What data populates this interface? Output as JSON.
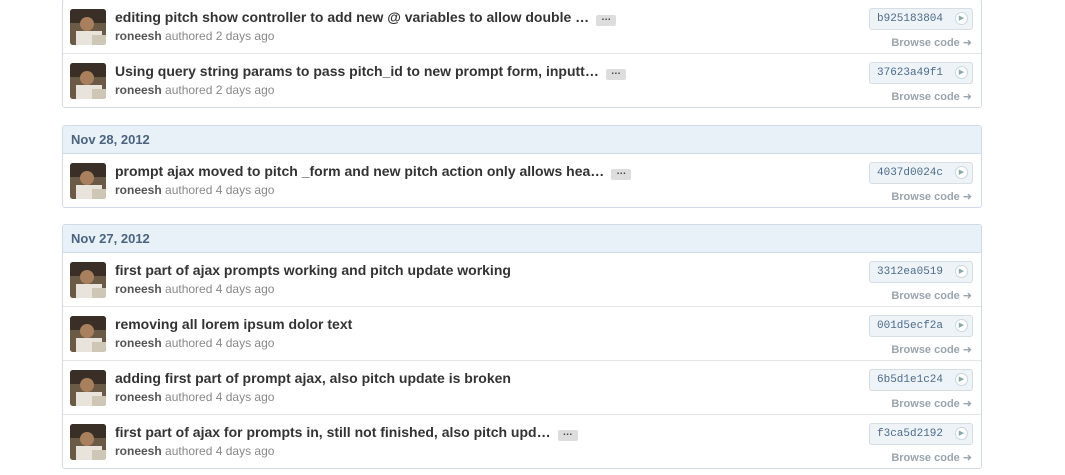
{
  "groups": [
    {
      "date": "",
      "commits": [
        {
          "message": "editing pitch show controller to add new @ variables to allow double …",
          "author": "roneesh",
          "authored": "authored 2 days ago",
          "sha": "b925183804",
          "browse": "Browse code"
        },
        {
          "message": "Using query string params to pass pitch_id to new prompt form, inputt…",
          "author": "roneesh",
          "authored": "authored 2 days ago",
          "sha": "37623a49f1",
          "browse": "Browse code"
        }
      ]
    },
    {
      "date": "Nov 28, 2012",
      "commits": [
        {
          "message": "prompt ajax moved to pitch _form and new pitch action only allows hea…",
          "author": "roneesh",
          "authored": "authored 4 days ago",
          "sha": "4037d0024c",
          "browse": "Browse code"
        }
      ]
    },
    {
      "date": "Nov 27, 2012",
      "commits": [
        {
          "message": "first part of ajax prompts working and pitch update working",
          "author": "roneesh",
          "authored": "authored 4 days ago",
          "sha": "3312ea0519",
          "browse": "Browse code"
        },
        {
          "message": "removing all lorem ipsum dolor text",
          "author": "roneesh",
          "authored": "authored 4 days ago",
          "sha": "001d5ecf2a",
          "browse": "Browse code"
        },
        {
          "message": "adding first part of prompt ajax, also pitch update is broken",
          "author": "roneesh",
          "authored": "authored 4 days ago",
          "sha": "6b5d1e1c24",
          "browse": "Browse code"
        },
        {
          "message": "first part of ajax for prompts in, still not finished, also pitch upd…",
          "author": "roneesh",
          "authored": "authored 4 days ago",
          "sha": "f3ca5d2192",
          "browse": "Browse code"
        }
      ]
    }
  ],
  "ellipsis_label": "…",
  "icons": {
    "sha_arrow": "arrow-right-circle-icon",
    "browse_arrow": "arrow-right-icon",
    "avatar": "user-avatar"
  },
  "colors": {
    "group_header_bg": "#e9f1f8",
    "group_border": "#cfdce7",
    "sha_text": "#4c6b8a",
    "browse_text": "#9aa4ad"
  }
}
